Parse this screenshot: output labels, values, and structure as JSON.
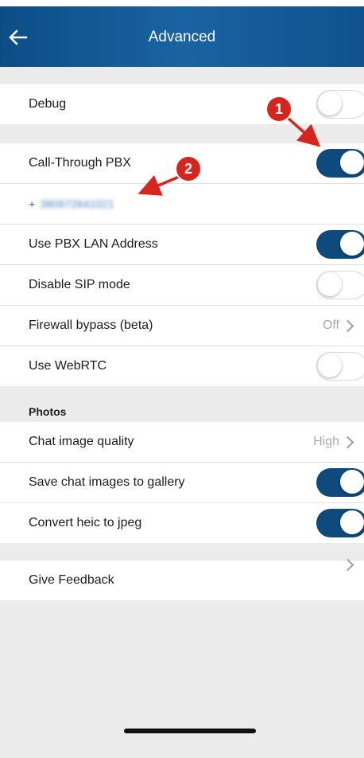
{
  "header": {
    "title": "Advanced"
  },
  "sections": {
    "debug": {
      "label": "Debug",
      "on": false
    },
    "call_through": {
      "label": "Call-Through PBX",
      "on": true,
      "phone_prefix": "+",
      "phone_digits": "380972641021"
    },
    "lan": {
      "label": "Use PBX LAN Address",
      "on": true
    },
    "sip": {
      "label": "Disable SIP mode",
      "on": false
    },
    "firewall": {
      "label": "Firewall bypass (beta)",
      "value": "Off"
    },
    "webrtc": {
      "label": "Use WebRTC",
      "on": false
    },
    "photos_header": "Photos",
    "image_quality": {
      "label": "Chat image quality",
      "value": "High"
    },
    "save_images": {
      "label": "Save chat images to gallery",
      "on": true
    },
    "heic": {
      "label": "Convert heic to jpeg",
      "on": true
    },
    "feedback": {
      "label": "Give Feedback"
    }
  },
  "annotations": {
    "badge_1": "1",
    "badge_2": "2"
  },
  "colors": {
    "header_blue": "#1a63a3",
    "toggle_on": "#0f4a7d",
    "annotation_red": "#d6251c",
    "link_blue": "#2f6fb6"
  }
}
